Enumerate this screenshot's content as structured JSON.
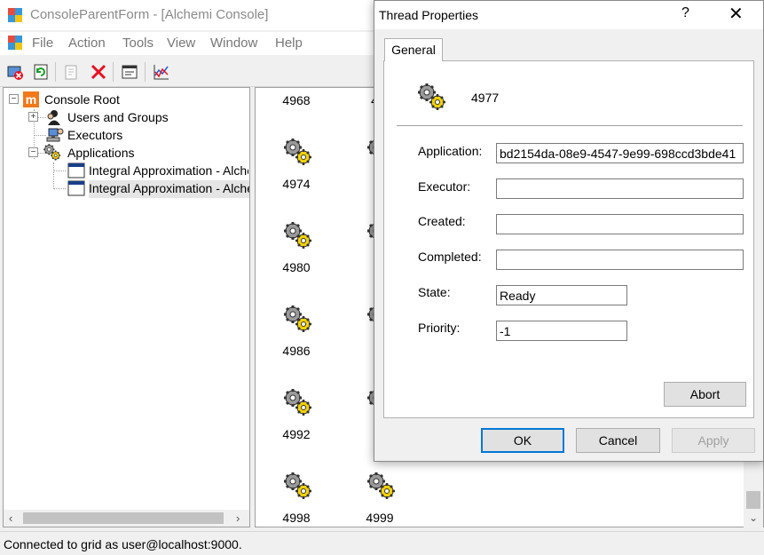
{
  "main_window": {
    "title": "ConsoleParentForm - [Alchemi Console]"
  },
  "menu": {
    "items": [
      "File",
      "Action",
      "Tools",
      "View",
      "Window",
      "Help"
    ]
  },
  "tree": {
    "root": "Console Root",
    "users_and_groups": "Users and Groups",
    "executors": "Executors",
    "applications": "Applications",
    "app_items": [
      "Integral Approximation - Alcher",
      "Integral Approximation - Alcher"
    ],
    "expander_plus": "+",
    "expander_minus": "−"
  },
  "thread_list": {
    "labels": [
      "4968",
      "4974",
      "4980",
      "4986",
      "4992",
      "4998",
      "4999"
    ]
  },
  "status_bar": {
    "text": "Connected to grid as user@localhost:9000."
  },
  "dialog": {
    "title": "Thread Properties",
    "help_glyph": "?",
    "close_glyph": "✕",
    "tab_general": "General",
    "thread_id": "4977",
    "labels": {
      "application": "Application:",
      "executor": "Executor:",
      "created": "Created:",
      "completed": "Completed:",
      "state": "State:",
      "priority": "Priority:"
    },
    "values": {
      "application": "bd2154da-08e9-4547-9e99-698ccd3bde41",
      "executor": "",
      "created": "",
      "completed": "",
      "state": "Ready",
      "priority": "-1"
    },
    "buttons": {
      "abort": "Abort",
      "ok": "OK",
      "cancel": "Cancel",
      "apply": "Apply"
    }
  },
  "colors": {
    "accent": "#0078d7",
    "selection": "#e5e5e5",
    "delete_red": "#e81123"
  }
}
